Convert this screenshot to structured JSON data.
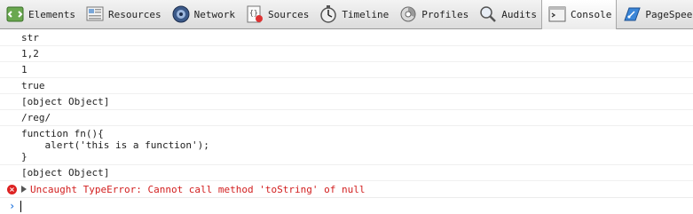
{
  "toolbar": {
    "tabs": [
      {
        "label": "Elements",
        "icon": "elements-icon"
      },
      {
        "label": "Resources",
        "icon": "resources-icon"
      },
      {
        "label": "Network",
        "icon": "network-icon"
      },
      {
        "label": "Sources",
        "icon": "sources-icon"
      },
      {
        "label": "Timeline",
        "icon": "timeline-icon"
      },
      {
        "label": "Profiles",
        "icon": "profiles-icon"
      },
      {
        "label": "Audits",
        "icon": "audits-icon"
      },
      {
        "label": "Console",
        "icon": "console-icon",
        "active": true
      },
      {
        "label": "PageSpeed",
        "icon": "pagespeed-icon"
      }
    ]
  },
  "console": {
    "lines": [
      "str",
      "1,2",
      "1",
      "true",
      "[object Object]",
      "/reg/",
      "function fn(){\n    alert('this is a function');\n}",
      "[object Object]"
    ],
    "error": "Uncaught TypeError: Cannot call method 'toString' of null",
    "error_color": "#d21e1e",
    "prompt_color": "#2a7adf"
  }
}
